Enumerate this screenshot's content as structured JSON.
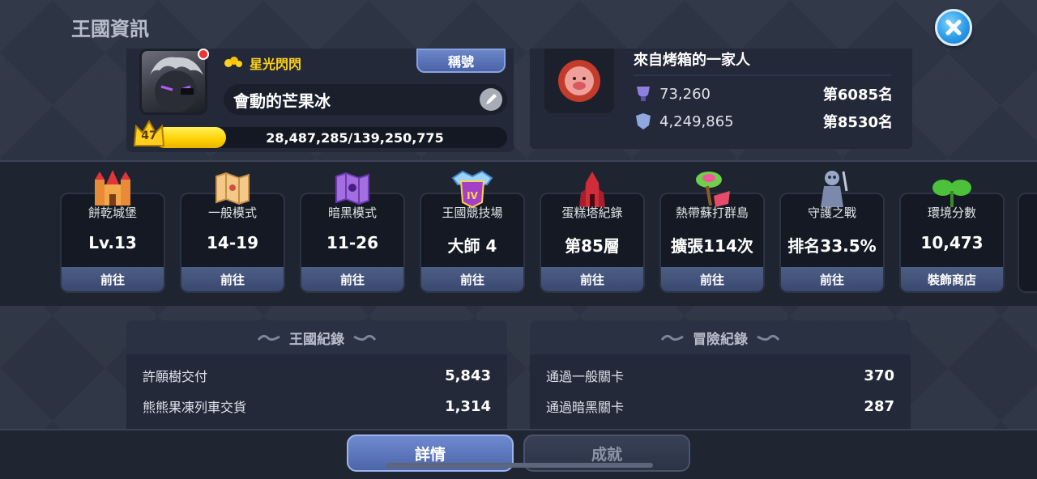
{
  "header": {
    "title": "王國資訊"
  },
  "profile": {
    "title_text": "星光閃閃",
    "title_button": "稱號",
    "player_name": "會動的芒果冰",
    "level": "47",
    "exp_text": "28,487,285/139,250,775",
    "exp_fraction": 0.2046
  },
  "family": {
    "name": "來自烤箱的一家人",
    "rows": [
      {
        "value": "73,260",
        "rank": "第6085名"
      },
      {
        "value": "4,249,865",
        "rank": "第8530名"
      }
    ]
  },
  "cards": [
    {
      "label": "餅乾城堡",
      "value": "Lv.13",
      "button": "前往"
    },
    {
      "label": "一般模式",
      "value": "14-19",
      "button": "前往"
    },
    {
      "label": "暗黑模式",
      "value": "11-26",
      "button": "前往"
    },
    {
      "label": "王國競技場",
      "value": "大師 4",
      "button": "前往"
    },
    {
      "label": "蛋糕塔紀錄",
      "value": "第85層",
      "button": "前往"
    },
    {
      "label": "熱帶蘇打群島",
      "value": "擴張114次",
      "button": "前往"
    },
    {
      "label": "守護之戰",
      "value": "排名33.5%",
      "button": "前往"
    },
    {
      "label": "環境分數",
      "value": "10,473",
      "button": "裝飾商店"
    }
  ],
  "kingdom_record": {
    "title": "王國紀錄",
    "rows": [
      {
        "label": "許願樹交付",
        "value": "5,843"
      },
      {
        "label": "熊熊果凍列車交貨",
        "value": "1,314"
      }
    ]
  },
  "adventure_record": {
    "title": "冒險紀錄",
    "rows": [
      {
        "label": "通過一般關卡",
        "value": "370"
      },
      {
        "label": "通過暗黑關卡",
        "value": "287"
      }
    ]
  },
  "tabs": {
    "details": "詳情",
    "achievements": "成就"
  },
  "icons": {
    "close": "close-icon",
    "edit": "pencil-icon",
    "level": "crown-icon",
    "card_icons": [
      "castle-icon",
      "map-icon",
      "dark-map-icon",
      "arena-icon",
      "tower-icon",
      "island-icon",
      "guardian-icon",
      "sprout-icon"
    ]
  },
  "colors": {
    "accent": "#2b9be8",
    "exp": "#ffd000",
    "button": "#4d5e85"
  }
}
